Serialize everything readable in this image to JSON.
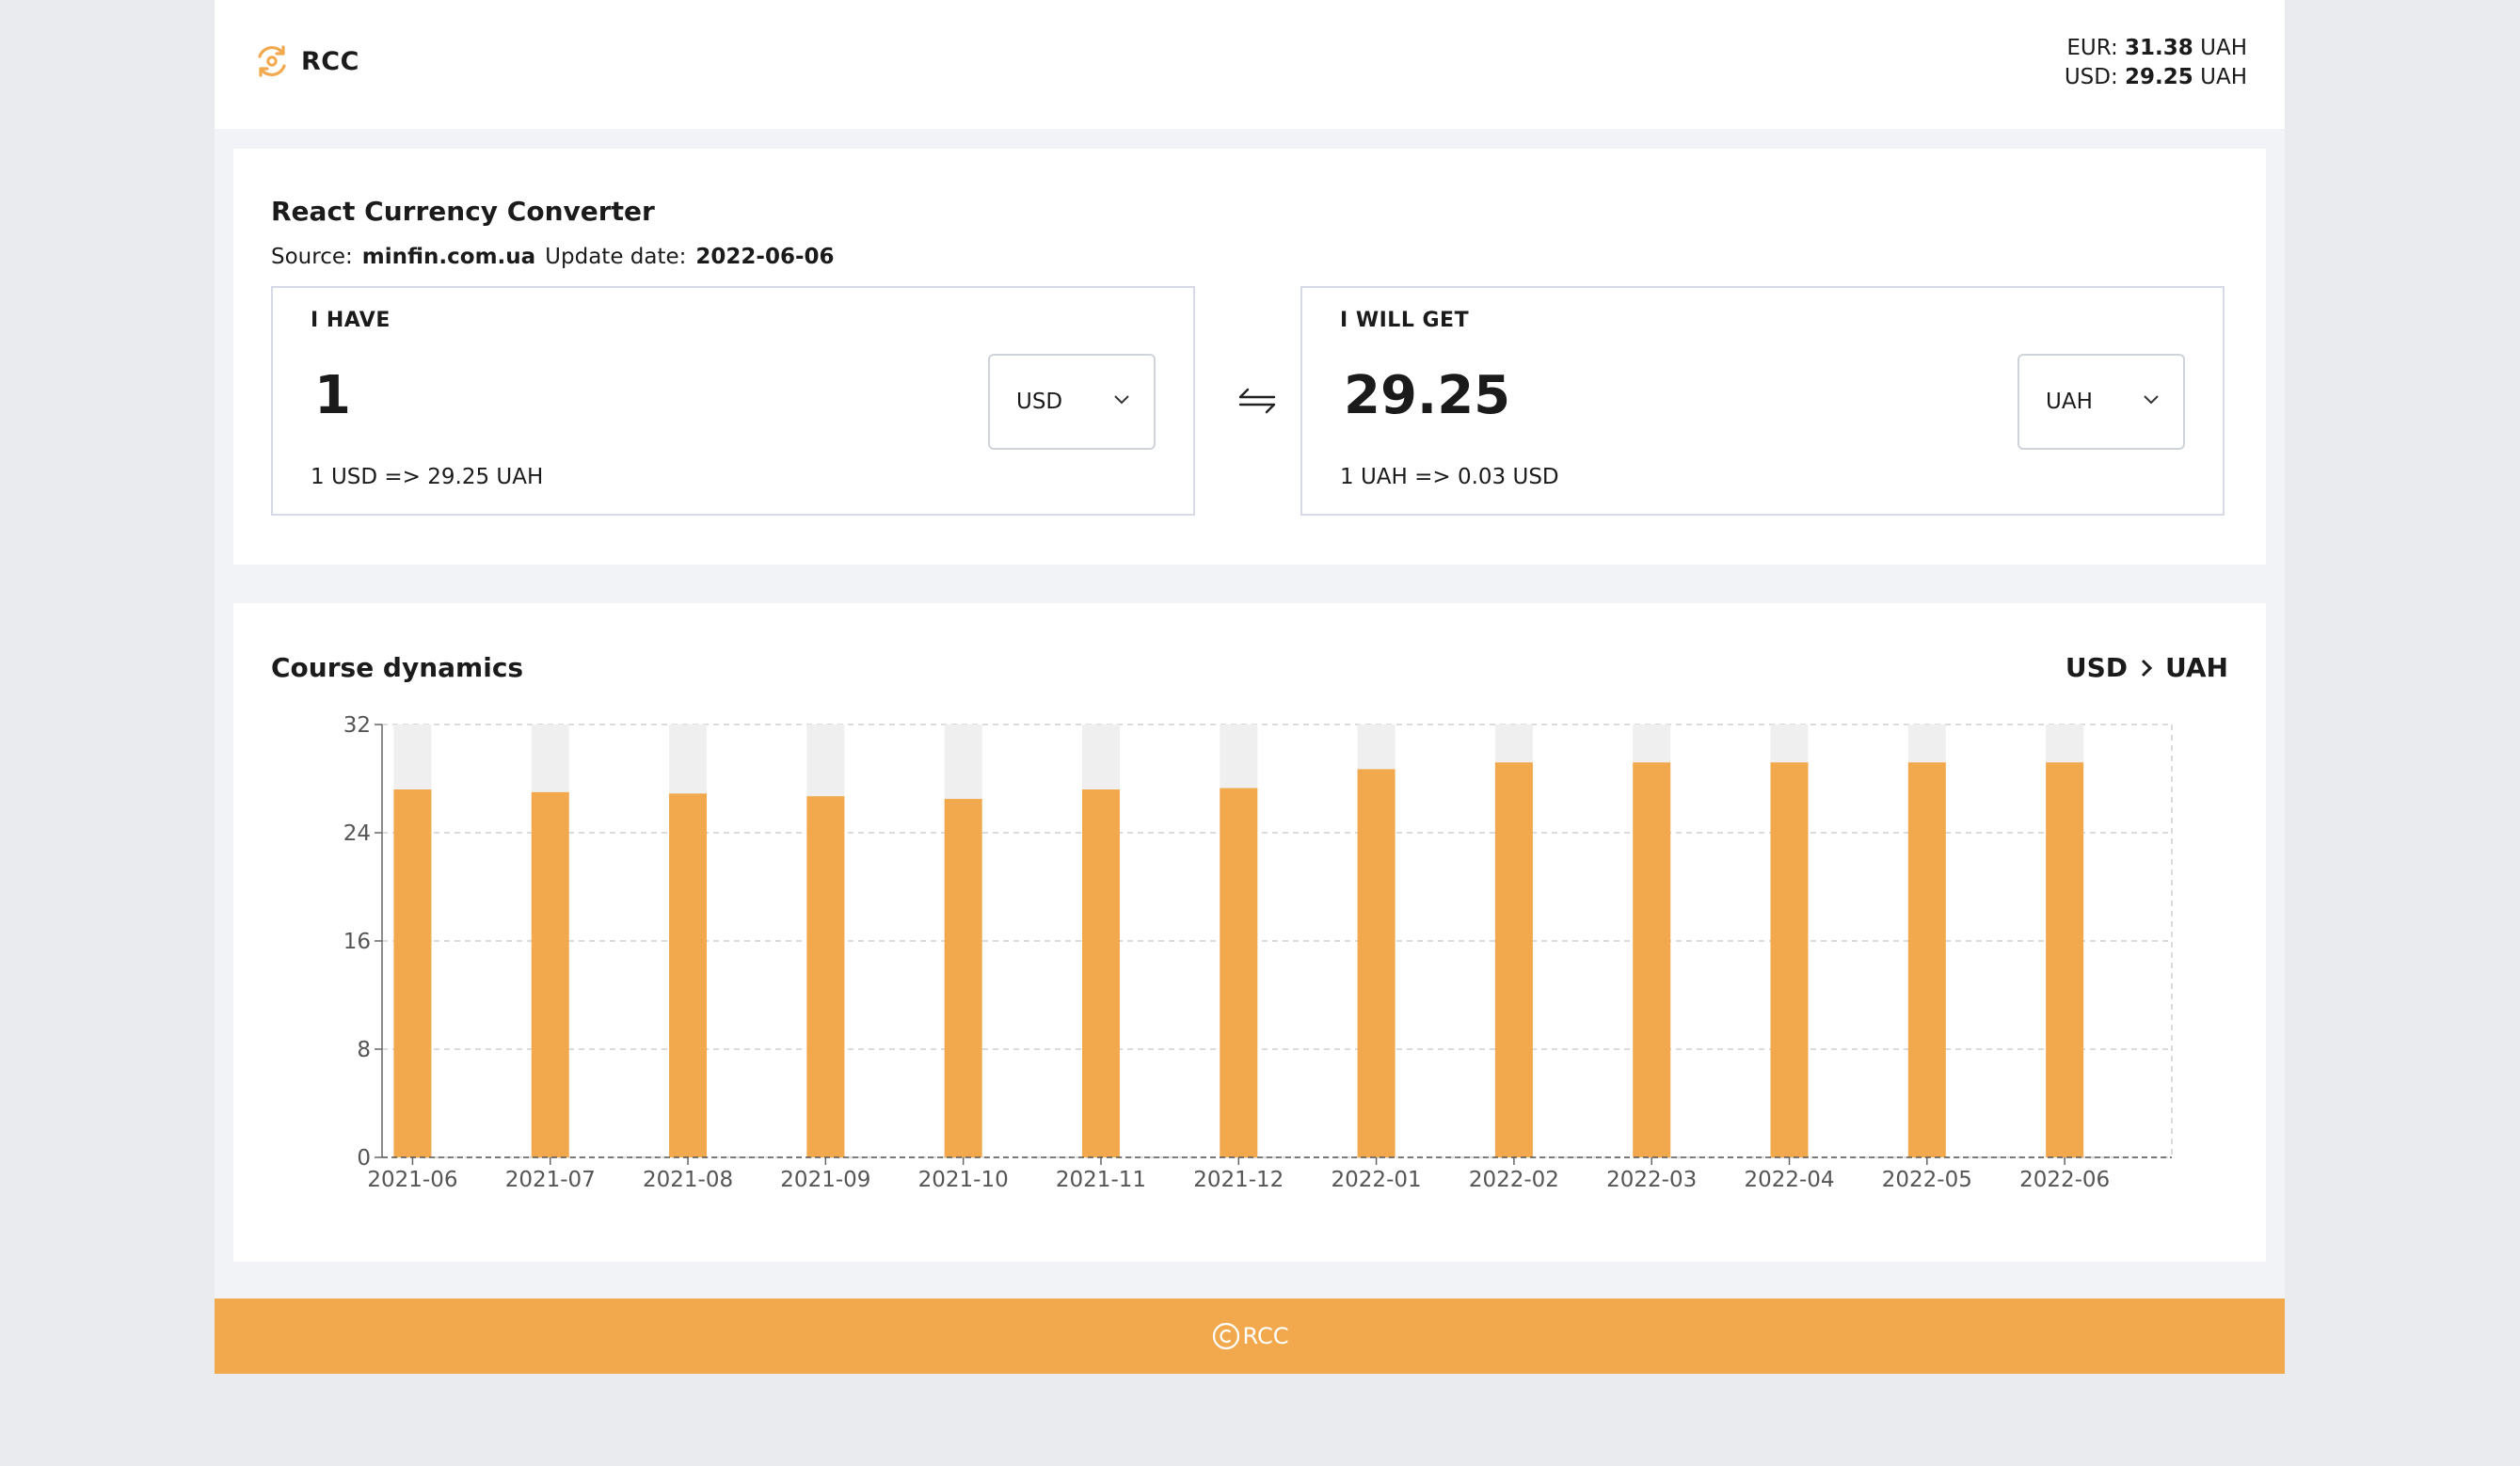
{
  "header": {
    "logo_text": "RCC",
    "rates": [
      {
        "code": "EUR:",
        "value": "31.38",
        "unit": "UAH"
      },
      {
        "code": "USD:",
        "value": "29.25",
        "unit": "UAH"
      }
    ]
  },
  "converter": {
    "title": "React Currency Converter",
    "source_label": "Source:",
    "source_value": "minfin.com.ua",
    "update_label": "Update date:",
    "update_value": "2022-06-06",
    "have": {
      "label": "I HAVE",
      "value": "1",
      "currency": "USD",
      "note": "1 USD => 29.25 UAH"
    },
    "get": {
      "label": "I WILL GET",
      "value": "29.25",
      "currency": "UAH",
      "note": "1 UAH => 0.03 USD"
    },
    "swap_icon": "swap-arrows-icon"
  },
  "dynamics": {
    "title": "Course dynamics",
    "pair_from": "USD",
    "pair_to": "UAH"
  },
  "chart_data": {
    "type": "bar",
    "categories": [
      "2021-06",
      "2021-07",
      "2021-08",
      "2021-09",
      "2021-10",
      "2021-11",
      "2021-12",
      "2022-01",
      "2022-02",
      "2022-03",
      "2022-04",
      "2022-05",
      "2022-06"
    ],
    "series": [
      {
        "values": [
          27.2,
          27.0,
          26.9,
          26.7,
          26.5,
          27.2,
          27.3,
          28.7,
          29.2,
          29.2,
          29.2,
          29.2,
          29.2
        ]
      }
    ],
    "ylim": [
      0,
      32
    ],
    "yticks": [
      0,
      8,
      16,
      24,
      32
    ],
    "grid": true,
    "colors": {
      "bar": "#f2a94e",
      "background_bar": "#efefef",
      "grid": "#cfcfcf"
    }
  },
  "footer": {
    "text": "RCC",
    "icon": "copyright-icon"
  },
  "colors": {
    "accent": "#f2a94e",
    "page_bg": "#e9ebef",
    "content_bg": "#f2f3f6"
  }
}
